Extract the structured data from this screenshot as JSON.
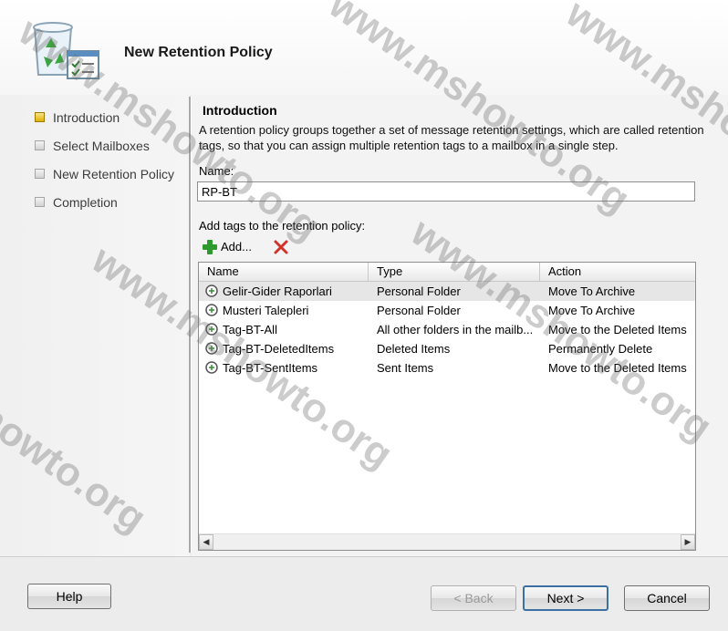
{
  "header": {
    "title": "New Retention Policy"
  },
  "steps": [
    {
      "label": "Introduction",
      "active": true
    },
    {
      "label": "Select Mailboxes",
      "active": false
    },
    {
      "label": "New Retention Policy",
      "active": false
    },
    {
      "label": "Completion",
      "active": false
    }
  ],
  "intro": {
    "title": "Introduction",
    "description": "A retention policy groups together a set of message retention settings, which are called retention tags, so that you can assign multiple retention tags to a mailbox in a single step.",
    "name_label": "Name:",
    "name_value": "RP-BT",
    "tags_label": "Add tags to the retention policy:",
    "add_label": "Add..."
  },
  "table": {
    "columns": [
      "Name",
      "Type",
      "Action"
    ],
    "rows": [
      {
        "name": "Gelir-Gider Raporlari",
        "type": "Personal Folder",
        "action": "Move To Archive"
      },
      {
        "name": "Musteri Talepleri",
        "type": "Personal Folder",
        "action": "Move To Archive"
      },
      {
        "name": "Tag-BT-All",
        "type": "All other folders in the mailb...",
        "action": "Move to the Deleted Items"
      },
      {
        "name": "Tag-BT-DeletedItems",
        "type": "Deleted Items",
        "action": "Permanently Delete"
      },
      {
        "name": "Tag-BT-SentItems",
        "type": "Sent Items",
        "action": "Move to the Deleted Items"
      }
    ]
  },
  "buttons": {
    "help": "Help",
    "back": "< Back",
    "next": "Next >",
    "cancel": "Cancel"
  },
  "watermark": "www.mshowto.org",
  "colors": {
    "accent": "#3d6fa0",
    "delete_icon": "#d0342c",
    "add_icon": "#2e9a2e",
    "active_step": "#e0b000"
  }
}
